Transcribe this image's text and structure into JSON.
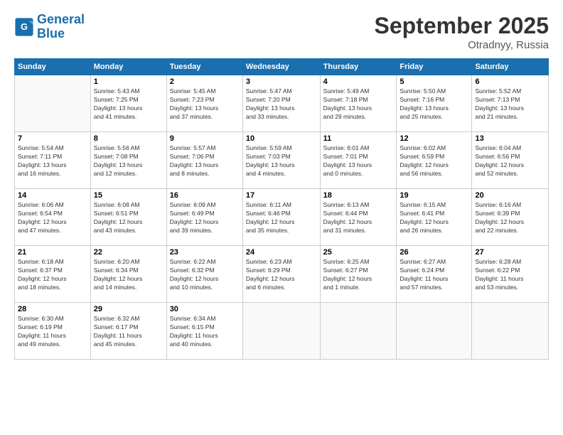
{
  "logo": {
    "line1": "General",
    "line2": "Blue"
  },
  "title": "September 2025",
  "subtitle": "Otradnyy, Russia",
  "days_of_week": [
    "Sunday",
    "Monday",
    "Tuesday",
    "Wednesday",
    "Thursday",
    "Friday",
    "Saturday"
  ],
  "weeks": [
    [
      {
        "day": "",
        "info": ""
      },
      {
        "day": "1",
        "info": "Sunrise: 5:43 AM\nSunset: 7:25 PM\nDaylight: 13 hours\nand 41 minutes."
      },
      {
        "day": "2",
        "info": "Sunrise: 5:45 AM\nSunset: 7:23 PM\nDaylight: 13 hours\nand 37 minutes."
      },
      {
        "day": "3",
        "info": "Sunrise: 5:47 AM\nSunset: 7:20 PM\nDaylight: 13 hours\nand 33 minutes."
      },
      {
        "day": "4",
        "info": "Sunrise: 5:49 AM\nSunset: 7:18 PM\nDaylight: 13 hours\nand 29 minutes."
      },
      {
        "day": "5",
        "info": "Sunrise: 5:50 AM\nSunset: 7:16 PM\nDaylight: 13 hours\nand 25 minutes."
      },
      {
        "day": "6",
        "info": "Sunrise: 5:52 AM\nSunset: 7:13 PM\nDaylight: 13 hours\nand 21 minutes."
      }
    ],
    [
      {
        "day": "7",
        "info": "Sunrise: 5:54 AM\nSunset: 7:11 PM\nDaylight: 13 hours\nand 16 minutes."
      },
      {
        "day": "8",
        "info": "Sunrise: 5:56 AM\nSunset: 7:08 PM\nDaylight: 13 hours\nand 12 minutes."
      },
      {
        "day": "9",
        "info": "Sunrise: 5:57 AM\nSunset: 7:06 PM\nDaylight: 13 hours\nand 8 minutes."
      },
      {
        "day": "10",
        "info": "Sunrise: 5:59 AM\nSunset: 7:03 PM\nDaylight: 13 hours\nand 4 minutes."
      },
      {
        "day": "11",
        "info": "Sunrise: 6:01 AM\nSunset: 7:01 PM\nDaylight: 13 hours\nand 0 minutes."
      },
      {
        "day": "12",
        "info": "Sunrise: 6:02 AM\nSunset: 6:59 PM\nDaylight: 12 hours\nand 56 minutes."
      },
      {
        "day": "13",
        "info": "Sunrise: 6:04 AM\nSunset: 6:56 PM\nDaylight: 12 hours\nand 52 minutes."
      }
    ],
    [
      {
        "day": "14",
        "info": "Sunrise: 6:06 AM\nSunset: 6:54 PM\nDaylight: 12 hours\nand 47 minutes."
      },
      {
        "day": "15",
        "info": "Sunrise: 6:08 AM\nSunset: 6:51 PM\nDaylight: 12 hours\nand 43 minutes."
      },
      {
        "day": "16",
        "info": "Sunrise: 6:09 AM\nSunset: 6:49 PM\nDaylight: 12 hours\nand 39 minutes."
      },
      {
        "day": "17",
        "info": "Sunrise: 6:11 AM\nSunset: 6:46 PM\nDaylight: 12 hours\nand 35 minutes."
      },
      {
        "day": "18",
        "info": "Sunrise: 6:13 AM\nSunset: 6:44 PM\nDaylight: 12 hours\nand 31 minutes."
      },
      {
        "day": "19",
        "info": "Sunrise: 6:15 AM\nSunset: 6:41 PM\nDaylight: 12 hours\nand 26 minutes."
      },
      {
        "day": "20",
        "info": "Sunrise: 6:16 AM\nSunset: 6:39 PM\nDaylight: 12 hours\nand 22 minutes."
      }
    ],
    [
      {
        "day": "21",
        "info": "Sunrise: 6:18 AM\nSunset: 6:37 PM\nDaylight: 12 hours\nand 18 minutes."
      },
      {
        "day": "22",
        "info": "Sunrise: 6:20 AM\nSunset: 6:34 PM\nDaylight: 12 hours\nand 14 minutes."
      },
      {
        "day": "23",
        "info": "Sunrise: 6:22 AM\nSunset: 6:32 PM\nDaylight: 12 hours\nand 10 minutes."
      },
      {
        "day": "24",
        "info": "Sunrise: 6:23 AM\nSunset: 6:29 PM\nDaylight: 12 hours\nand 6 minutes."
      },
      {
        "day": "25",
        "info": "Sunrise: 6:25 AM\nSunset: 6:27 PM\nDaylight: 12 hours\nand 1 minute."
      },
      {
        "day": "26",
        "info": "Sunrise: 6:27 AM\nSunset: 6:24 PM\nDaylight: 11 hours\nand 57 minutes."
      },
      {
        "day": "27",
        "info": "Sunrise: 6:28 AM\nSunset: 6:22 PM\nDaylight: 11 hours\nand 53 minutes."
      }
    ],
    [
      {
        "day": "28",
        "info": "Sunrise: 6:30 AM\nSunset: 6:19 PM\nDaylight: 11 hours\nand 49 minutes."
      },
      {
        "day": "29",
        "info": "Sunrise: 6:32 AM\nSunset: 6:17 PM\nDaylight: 11 hours\nand 45 minutes."
      },
      {
        "day": "30",
        "info": "Sunrise: 6:34 AM\nSunset: 6:15 PM\nDaylight: 11 hours\nand 40 minutes."
      },
      {
        "day": "",
        "info": ""
      },
      {
        "day": "",
        "info": ""
      },
      {
        "day": "",
        "info": ""
      },
      {
        "day": "",
        "info": ""
      }
    ]
  ]
}
